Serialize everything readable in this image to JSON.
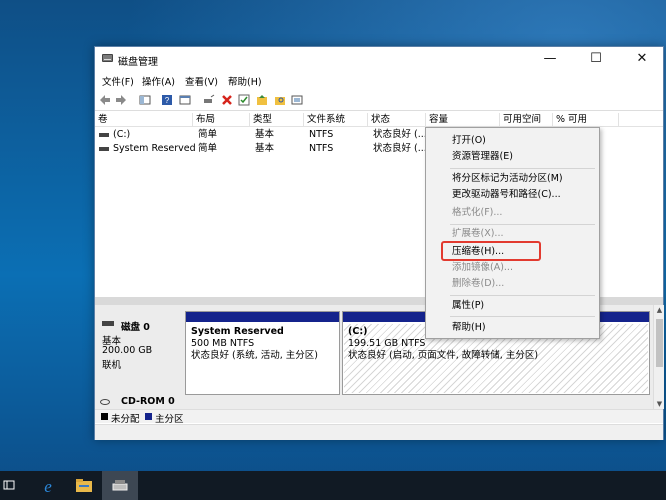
{
  "window": {
    "title": "磁盘管理",
    "controls": {
      "minimize": "—",
      "maximize": "☐",
      "close": "✕"
    }
  },
  "menubar": [
    "文件(F)",
    "操作(A)",
    "查看(V)",
    "帮助(H)"
  ],
  "volume_table": {
    "columns": [
      "卷",
      "布局",
      "类型",
      "文件系统",
      "状态",
      "容量",
      "可用空间",
      "% 可用"
    ],
    "rows": [
      {
        "volume": "(C:)",
        "layout": "简单",
        "type": "基本",
        "fs": "NTFS",
        "status": "状态良好 (..."
      },
      {
        "volume": "System Reserved",
        "layout": "简单",
        "type": "基本",
        "fs": "NTFS",
        "status": "状态良好 (..."
      }
    ]
  },
  "disk0": {
    "name": "磁盘 0",
    "type": "基本",
    "size": "200.00 GB",
    "state": "联机",
    "partitions": [
      {
        "name": "System Reserved",
        "size": "500 MB NTFS",
        "status": "状态良好 (系统, 活动, 主分区)"
      },
      {
        "name": "(C:)",
        "size": "199.51 GB NTFS",
        "status": "状态良好 (启动, 页面文件, 故障转储, 主分区)"
      }
    ]
  },
  "cdrom": {
    "name": "CD-ROM 0"
  },
  "legend": {
    "unallocated": "未分配",
    "primary": "主分区",
    "unallocated_color": "#000000",
    "primary_color": "#14238c"
  },
  "context_menu": [
    {
      "label": "打开(O)",
      "enabled": true
    },
    {
      "label": "资源管理器(E)",
      "enabled": true
    },
    {
      "label": "将分区标记为活动分区(M)",
      "enabled": true
    },
    {
      "label": "更改驱动器号和路径(C)...",
      "enabled": true
    },
    {
      "label": "格式化(F)...",
      "enabled": false
    },
    {
      "label": "扩展卷(X)...",
      "enabled": false
    },
    {
      "label": "压缩卷(H)...",
      "enabled": true,
      "highlighted": true
    },
    {
      "label": "添加镜像(A)...",
      "enabled": false
    },
    {
      "label": "删除卷(D)...",
      "enabled": false
    },
    {
      "label": "属性(P)",
      "enabled": true
    },
    {
      "label": "帮助(H)",
      "enabled": true
    }
  ],
  "colors": {
    "highlight_outline": "#e23a2f",
    "partition_header": "#14238c"
  },
  "taskbar": {
    "icons": [
      "task-view-icon",
      "edge-icon",
      "file-explorer-icon",
      "disk-management-icon"
    ]
  }
}
